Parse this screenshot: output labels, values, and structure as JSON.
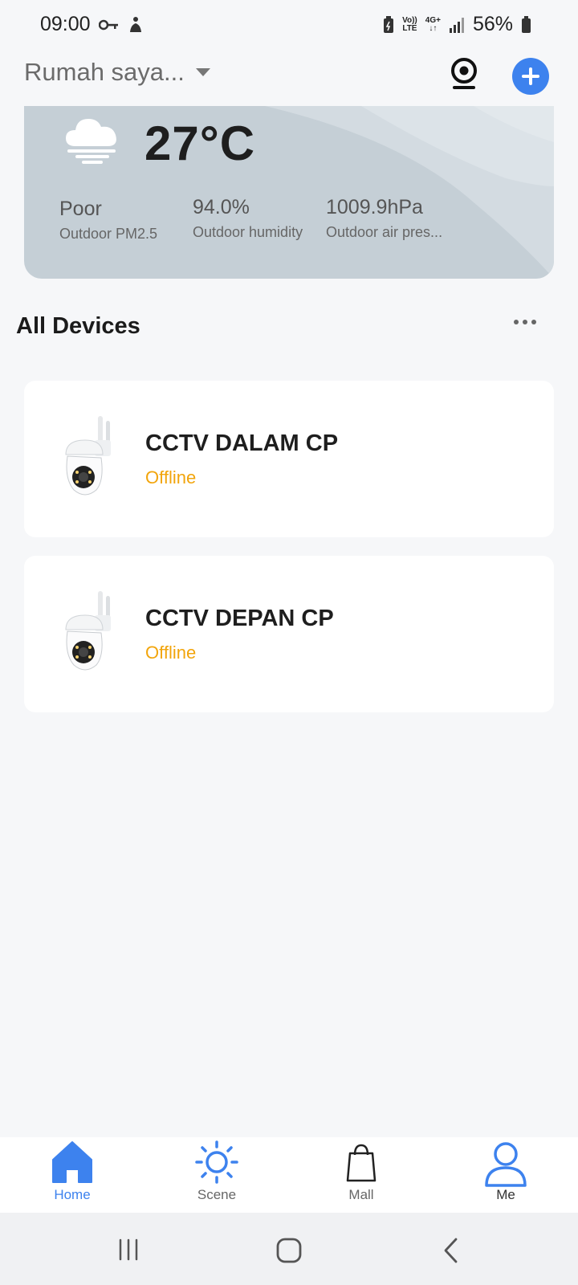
{
  "status_bar": {
    "time": "09:00",
    "network_top": "Vo))",
    "network_bottom": "LTE",
    "gen_top": "4G+",
    "battery": "56%",
    "icons": [
      "key-icon",
      "accessibility-icon",
      "battery-saver-icon",
      "signal-icon",
      "battery-icon"
    ]
  },
  "header": {
    "home_name": "Rumah saya...",
    "icons": [
      "camera-icon",
      "add-icon"
    ],
    "accent": "#3d82ee"
  },
  "weather": {
    "temperature": "27°C",
    "icon": "cloud-fog-icon",
    "stats": [
      {
        "value": "Poor",
        "label": "Outdoor PM2.5"
      },
      {
        "value": "94.0%",
        "label": "Outdoor humidity"
      },
      {
        "value": "1009.9hPa",
        "label": "Outdoor air pres..."
      }
    ]
  },
  "devices_section": {
    "title": "All Devices",
    "devices": [
      {
        "name": "CCTV DALAM CP",
        "status": "Offline",
        "icon": "ptz-camera-image"
      },
      {
        "name": "CCTV DEPAN CP",
        "status": "Offline",
        "icon": "ptz-camera-image"
      }
    ],
    "status_color": "#f2a50c"
  },
  "tabs": [
    {
      "label": "Home",
      "icon": "home-icon",
      "active": true
    },
    {
      "label": "Scene",
      "icon": "sun-icon",
      "active": false
    },
    {
      "label": "Mall",
      "icon": "bag-icon",
      "active": false
    },
    {
      "label": "Me",
      "icon": "person-icon",
      "active": false
    }
  ],
  "colors": {
    "tab_active": "#3d82ee",
    "tab_inactive": "#666666"
  }
}
